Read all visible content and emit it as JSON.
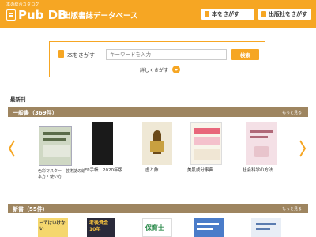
{
  "header": {
    "logo_subtitle": "本の総合カタログ",
    "logo_text": "Pub DB",
    "site_title": "出版書誌データベース",
    "btn_book": "本をさがす",
    "btn_publisher": "出版社をさがす",
    "bg_color": "#f6a623"
  },
  "search": {
    "label": "本をさがす",
    "placeholder": "キーワードを入力",
    "button": "検索",
    "detail_link": "詳しくさがす"
  },
  "newest_label": "最新刊",
  "section_general": {
    "title": "一般書（369件）",
    "more": "もっと見る",
    "books": [
      {
        "title": "色彩マスター　芸術誌の絵本方・使い方"
      },
      {
        "title": "FP手帳　2020年版"
      },
      {
        "title": "虚と飾"
      },
      {
        "title": "美肌成分事典"
      },
      {
        "title": "社会科学の方法"
      }
    ]
  },
  "section_new": {
    "title": "新書（55件）",
    "more": "もっと見る",
    "books": [
      {
        "cover_text": "ってはいけない"
      },
      {
        "cover_text": "老後資金10年"
      },
      {
        "cover_text": "保育士"
      },
      {
        "cover_text": ""
      },
      {
        "cover_text": ""
      }
    ]
  },
  "colors": {
    "accent": "#f6a623",
    "section_bar": "#9e8560"
  }
}
